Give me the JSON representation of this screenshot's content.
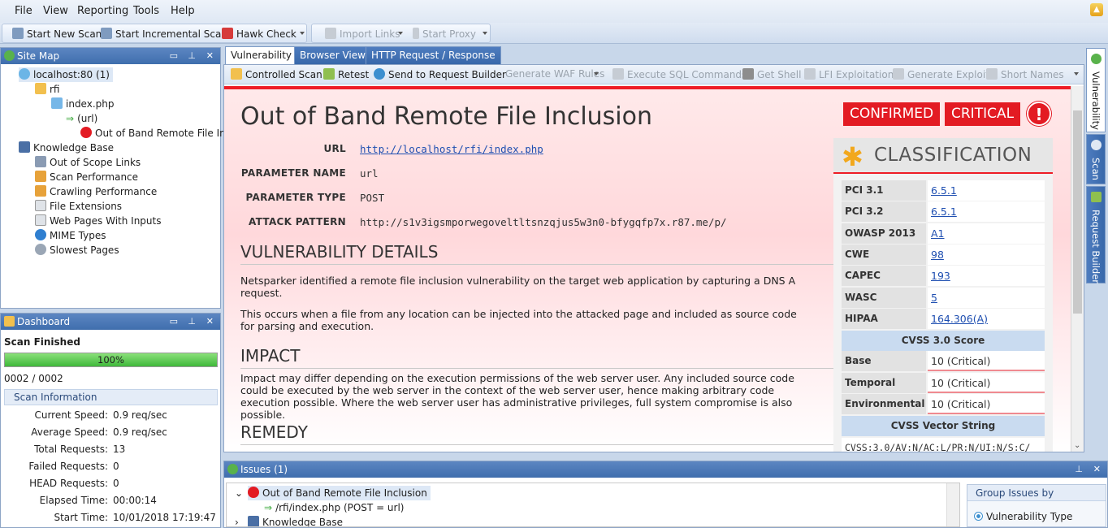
{
  "menu": [
    "File",
    "View",
    "Reporting",
    "Tools",
    "Help"
  ],
  "toolbar": {
    "start_new_scan": "Start New Scan",
    "start_incremental_scan": "Start Incremental Scan",
    "hawk_check": "Hawk Check",
    "import_links": "Import Links",
    "start_proxy": "Start Proxy"
  },
  "site_map": {
    "title": "Site Map",
    "items": [
      {
        "label": "localhost:80 (1)"
      },
      {
        "label": "rfi"
      },
      {
        "label": "index.php"
      },
      {
        "label": "(url)"
      },
      {
        "label": "Out of Band Remote File Incl"
      },
      {
        "label": "Knowledge Base"
      },
      {
        "label": "Out of Scope Links"
      },
      {
        "label": "Scan Performance"
      },
      {
        "label": "Crawling Performance"
      },
      {
        "label": "File Extensions"
      },
      {
        "label": "Web Pages With Inputs"
      },
      {
        "label": "MIME Types"
      },
      {
        "label": "Slowest Pages"
      }
    ]
  },
  "dashboard": {
    "title": "Dashboard",
    "status": "Scan Finished",
    "progress_label": "100%",
    "progress": 1.0,
    "counter": "0002 / 0002",
    "scan_info_title": "Scan Information",
    "rows": [
      {
        "label": "Current Speed:",
        "value": "0.9 req/sec"
      },
      {
        "label": "Average Speed:",
        "value": "0.9 req/sec"
      },
      {
        "label": "Total Requests:",
        "value": "13"
      },
      {
        "label": "Failed Requests:",
        "value": "0"
      },
      {
        "label": "HEAD Requests:",
        "value": "0"
      },
      {
        "label": "Elapsed Time:",
        "value": "00:00:14"
      },
      {
        "label": "Start Time:",
        "value": "10/01/2018 17:19:47"
      }
    ]
  },
  "doc_tabs": [
    "Vulnerability",
    "Browser View",
    "HTTP Request / Response"
  ],
  "doc_toolbar": {
    "controlled_scan": "Controlled Scan",
    "retest": "Retest",
    "send_to_request_builder": "Send to Request Builder",
    "generate_waf_rules": "Generate WAF Rules",
    "execute_sql_commands": "Execute SQL Commands",
    "get_shell": "Get Shell",
    "lfi_exploitation": "LFI Exploitation",
    "generate_exploit": "Generate Exploit",
    "short_names": "Short Names"
  },
  "report": {
    "title": "Out of Band Remote File Inclusion",
    "badge_confirmed": "CONFIRMED",
    "badge_critical": "CRITICAL",
    "badge_icon": "!",
    "fields": {
      "url_label": "URL",
      "url_value": "http://localhost/rfi/index.php",
      "param_name_label": "PARAMETER NAME",
      "param_name_value": "url",
      "param_type_label": "PARAMETER TYPE",
      "param_type_value": "POST",
      "attack_label": "ATTACK PATTERN",
      "attack_value": "http://s1v3igsmporwegoveltltsnzqjus5w3n0-bfygqfp7x.r87.me/p/"
    },
    "vuln_details_heading": "VULNERABILITY DETAILS",
    "vuln_details_p1": "Netsparker identified a remote file inclusion vulnerability on the target web application by capturing a DNS A request.",
    "vuln_details_p2": "This occurs when a file from any location can be injected into the attacked page and included as source code for parsing and execution.",
    "impact_heading": "IMPACT",
    "impact_p": "Impact may differ depending on the execution permissions of the web server user. Any included source code could be executed by the web server in the context of the web server user, hence making arbitrary code execution possible. Where the web server user has administrative privileges, full system compromise is also possible.",
    "remedy_heading": "REMEDY"
  },
  "classification": {
    "title": "CLASSIFICATION",
    "rows": [
      {
        "label": "PCI 3.1",
        "value": "6.5.1"
      },
      {
        "label": "PCI 3.2",
        "value": "6.5.1"
      },
      {
        "label": "OWASP 2013",
        "value": "A1"
      },
      {
        "label": "CWE",
        "value": "98"
      },
      {
        "label": "CAPEC",
        "value": "193"
      },
      {
        "label": "WASC",
        "value": "5"
      },
      {
        "label": "HIPAA",
        "value": "164.306(A)"
      }
    ],
    "cvss_title": "CVSS 3.0 Score",
    "cvss_rows": [
      {
        "label": "Base",
        "value": "10 (Critical)"
      },
      {
        "label": "Temporal",
        "value": "10 (Critical)"
      },
      {
        "label": "Environmental",
        "value": "10 (Critical)"
      }
    ],
    "vector_title": "CVSS Vector String",
    "vector_value": "CVSS:3.0/AV:N/AC:L/PR:N/UI:N/S:C/"
  },
  "side_tabs": [
    "Vulnerability",
    "Scan",
    "Request Builder"
  ],
  "issues": {
    "title": "Issues (1)",
    "items": [
      {
        "label": "Out of Band Remote File Inclusion"
      },
      {
        "label": "/rfi/index.php (POST = url)"
      },
      {
        "label": "Knowledge Base"
      }
    ],
    "group_title": "Group Issues by",
    "group_option": "Vulnerability Type"
  },
  "colors": {
    "accent_red": "#e31b23",
    "link_blue": "#1f4fb1",
    "panel_header": "#4a79b8",
    "progress_green": "#3fb83a"
  }
}
